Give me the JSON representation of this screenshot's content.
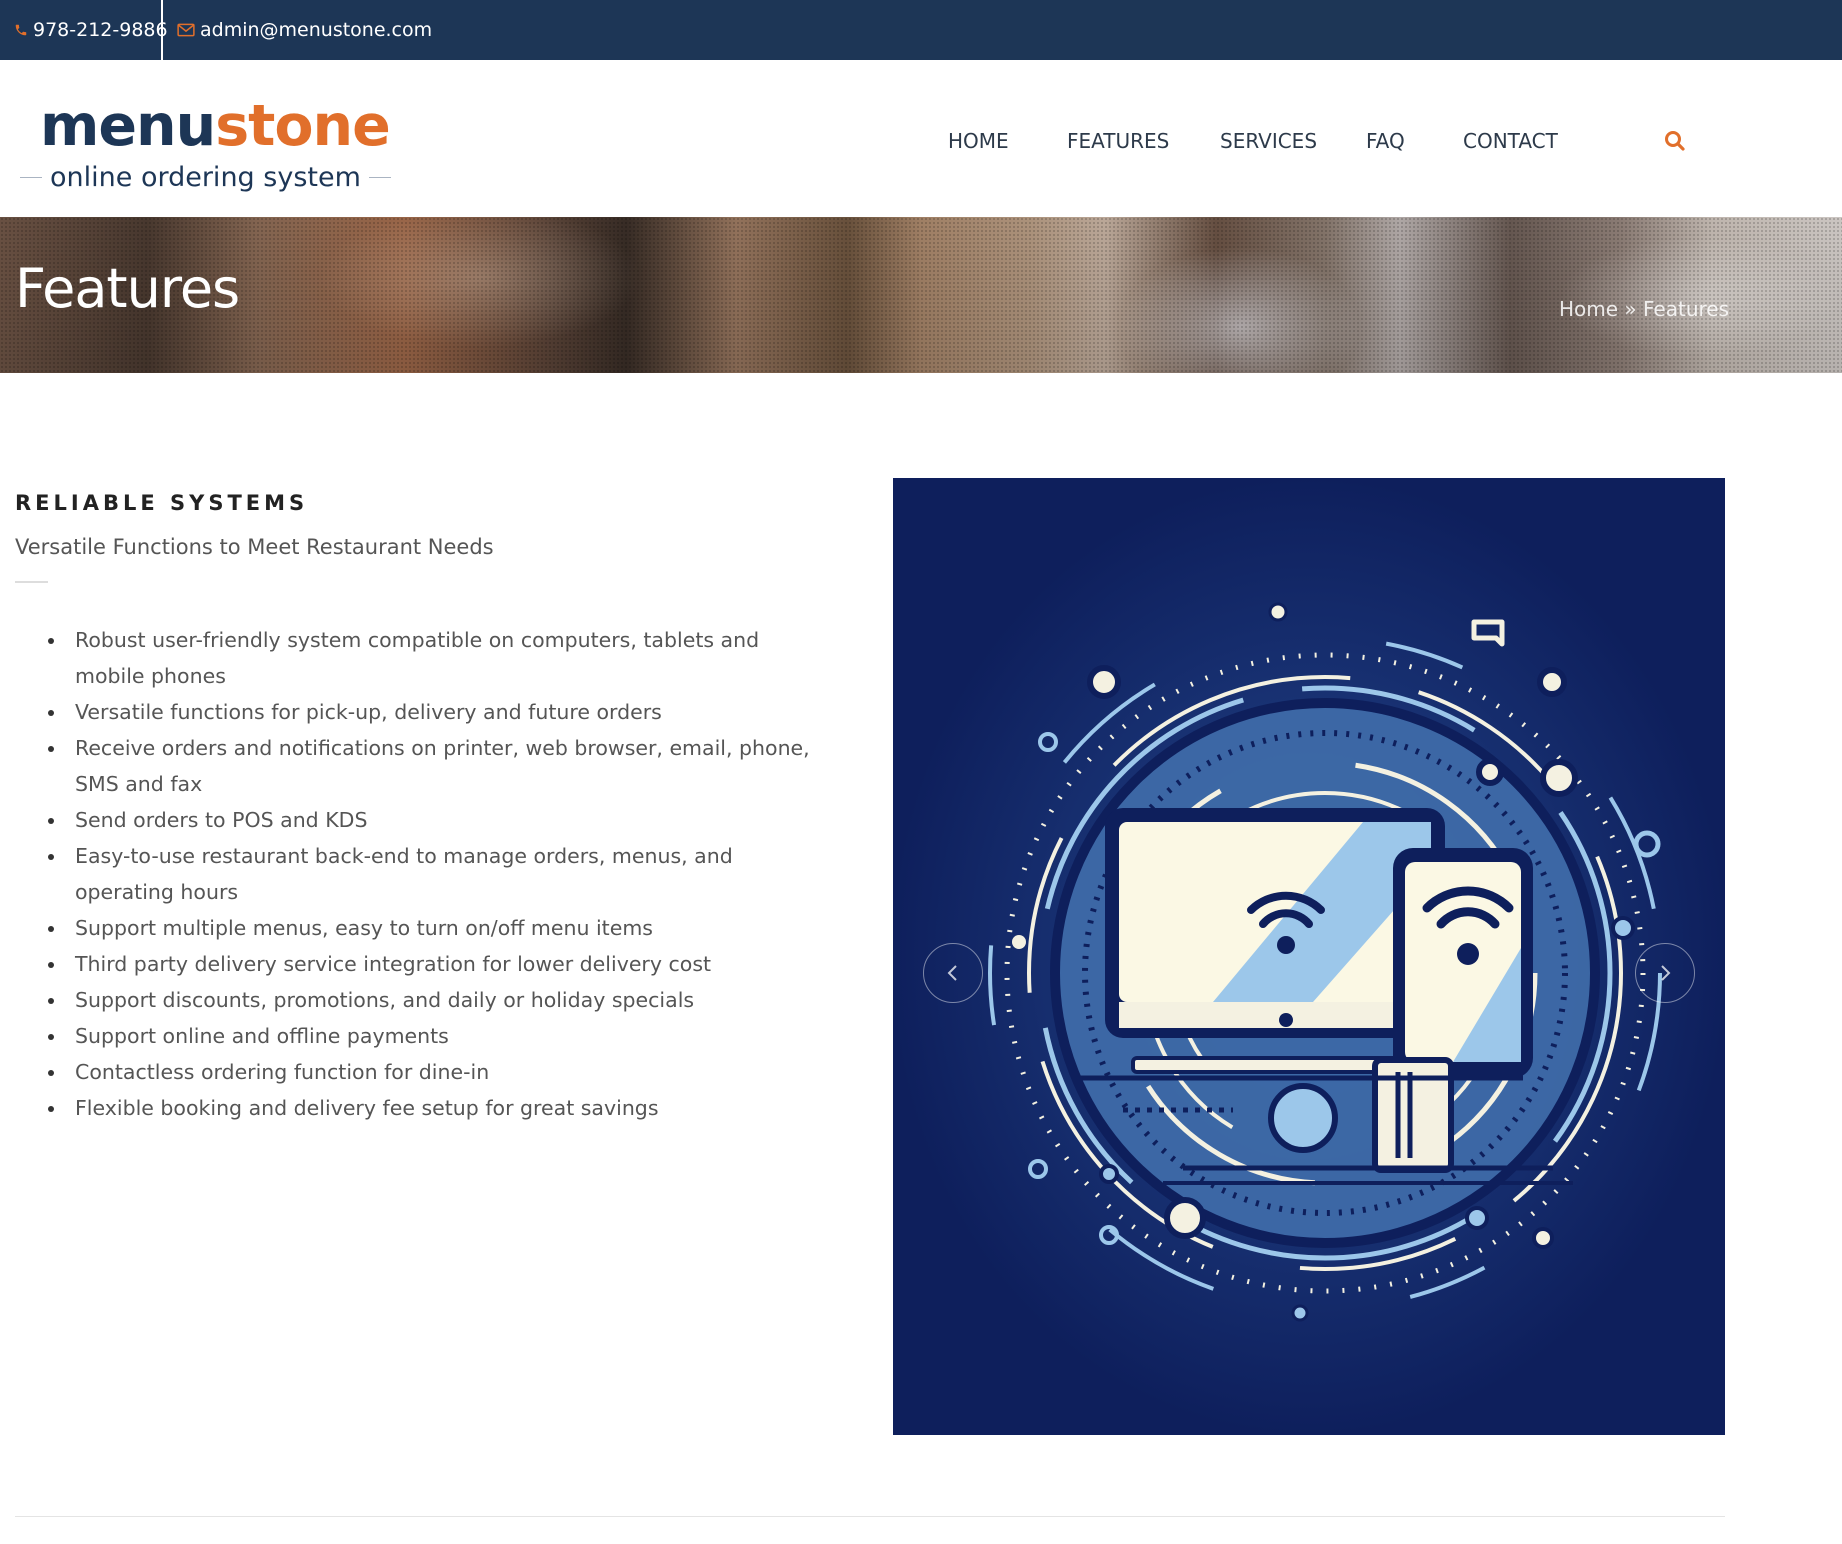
{
  "topbar": {
    "phone": "978-212-9886",
    "email": "admin@menustone.com",
    "phone_icon": "phone-icon",
    "email_icon": "envelope-icon"
  },
  "logo": {
    "wordmark_part1": "menu",
    "wordmark_part2": "stone",
    "tagline": "online ordering system"
  },
  "nav": {
    "items": [
      {
        "label": "HOME"
      },
      {
        "label": "FEATURES"
      },
      {
        "label": "SERVICES"
      },
      {
        "label": "FAQ"
      },
      {
        "label": "CONTACT"
      }
    ],
    "search_icon": "search-icon"
  },
  "banner": {
    "title": "Features",
    "breadcrumb": "Home » Features"
  },
  "content": {
    "title": "RELIABLE SYSTEMS",
    "subtitle": "Versatile Functions to Meet Restaurant Needs",
    "features": [
      "Robust user-friendly system compatible on computers, tablets and mobile phones",
      "Versatile functions for pick-up, delivery and future orders",
      "Receive orders and notifications on printer, web browser, email, phone, SMS and fax",
      "Send orders to POS and KDS",
      "Easy-to-use restaurant back-end to manage orders, menus, and operating hours",
      "Support multiple menus, easy to turn on/off menu items",
      "Third party delivery service integration for lower delivery cost",
      "Support discounts, promotions, and daily or holiday specials",
      "Support online and offline payments",
      "Contactless ordering function for dine-in",
      "Flexible booking and delivery fee setup for great savings"
    ]
  },
  "slider": {
    "prev_icon": "chevron-left-icon",
    "next_icon": "chevron-right-icon"
  },
  "colors": {
    "topbar_bg": "#1d3656",
    "accent": "#e16f2b",
    "panel_bg": "#1a3577"
  }
}
